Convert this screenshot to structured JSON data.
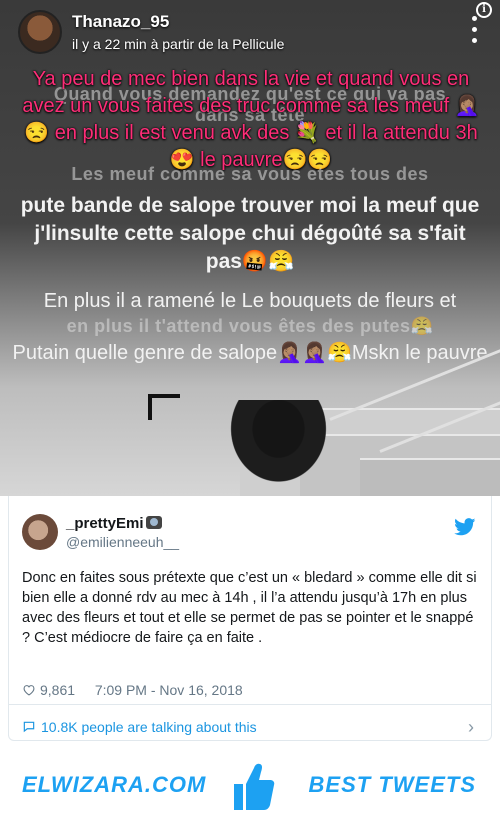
{
  "snap": {
    "username": "Thanazo_95",
    "time": "il y a 22 min à partir de la Pellicule",
    "caption_pink": "Ya peu de mec bien dans la vie et quand vous en avez un vous faites des truc comme sa les meuf 🤦🏽‍♀️😒 en plus il est venu avk des 💐 et il la attendu 3h😍 le pauvre😒😒",
    "ghost_1": "Quand vous demandez qu'est ce qui va pas dans sa tête",
    "ghost_2": "Les meuf comme sa vous etes tous des",
    "caption_main": "pute bande de salope trouver moi la meuf que j'linsulte cette salope chui dégoûté sa s'fait pas🤬😤",
    "caption_second": "En plus il a ramené le Le bouquets de fleurs et",
    "ghost_3": "en plus il t'attend vous êtes des putes😤",
    "caption_third": "Putain quelle genre de salope🤦🏽‍♀️🤦🏽‍♀️😤Mskn le pauvre"
  },
  "tweet": {
    "name": "_prettyEmi",
    "handle": "@emilienneeuh__",
    "text": "Donc en faites sous prétexte que c’est un « bledard » comme elle dit si bien elle a donné rdv au mec à 14h , il l’a attendu jusqu’à 17h en plus avec des fleurs et tout et elle se permet de pas se pointer et le snappé ? C’est médiocre de faire ça en faite .",
    "likes": "9,861",
    "timestamp": "7:09 PM - Nov 16, 2018",
    "talking": "10.8K people are talking about this",
    "colors": {
      "link": "#1b95e0",
      "muted": "#657786"
    }
  },
  "footer": {
    "left": "ELWIZARA.COM",
    "right": "BEST TWEETS",
    "accent": "#1da1f2"
  }
}
